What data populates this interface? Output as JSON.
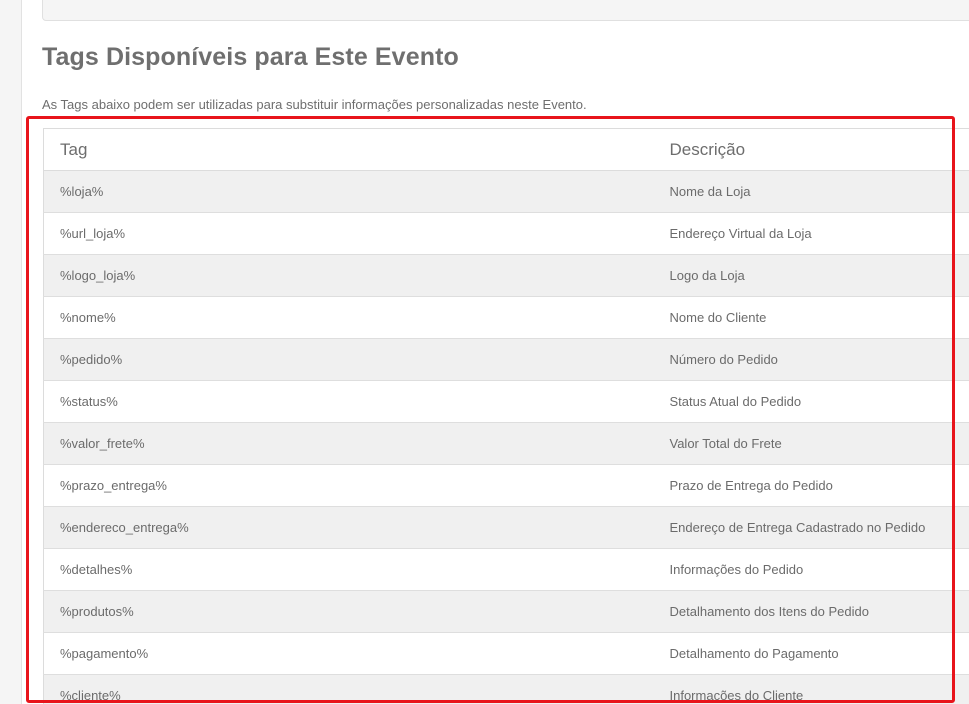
{
  "section": {
    "title": "Tags Disponíveis para Este Evento",
    "description": "As Tags abaixo podem ser utilizadas para substituir informações personalizadas neste Evento."
  },
  "table": {
    "headers": {
      "tag": "Tag",
      "description": "Descrição"
    },
    "rows": [
      {
        "tag": "%loja%",
        "description": "Nome da Loja"
      },
      {
        "tag": "%url_loja%",
        "description": "Endereço Virtual da Loja"
      },
      {
        "tag": "%logo_loja%",
        "description": "Logo da Loja"
      },
      {
        "tag": "%nome%",
        "description": "Nome do Cliente"
      },
      {
        "tag": "%pedido%",
        "description": "Número do Pedido"
      },
      {
        "tag": "%status%",
        "description": "Status Atual do Pedido"
      },
      {
        "tag": "%valor_frete%",
        "description": "Valor Total do Frete"
      },
      {
        "tag": "%prazo_entrega%",
        "description": "Prazo de Entrega do Pedido"
      },
      {
        "tag": "%endereco_entrega%",
        "description": "Endereço de Entrega Cadastrado no Pedido"
      },
      {
        "tag": "%detalhes%",
        "description": "Informações do Pedido"
      },
      {
        "tag": "%produtos%",
        "description": "Detalhamento dos Itens do Pedido"
      },
      {
        "tag": "%pagamento%",
        "description": "Detalhamento do Pagamento"
      },
      {
        "tag": "%cliente%",
        "description": "Informações do Cliente"
      }
    ]
  },
  "colors": {
    "highlight": "#e8141b",
    "row_stripe": "#f0f0f0",
    "text": "#6b6b6b"
  }
}
